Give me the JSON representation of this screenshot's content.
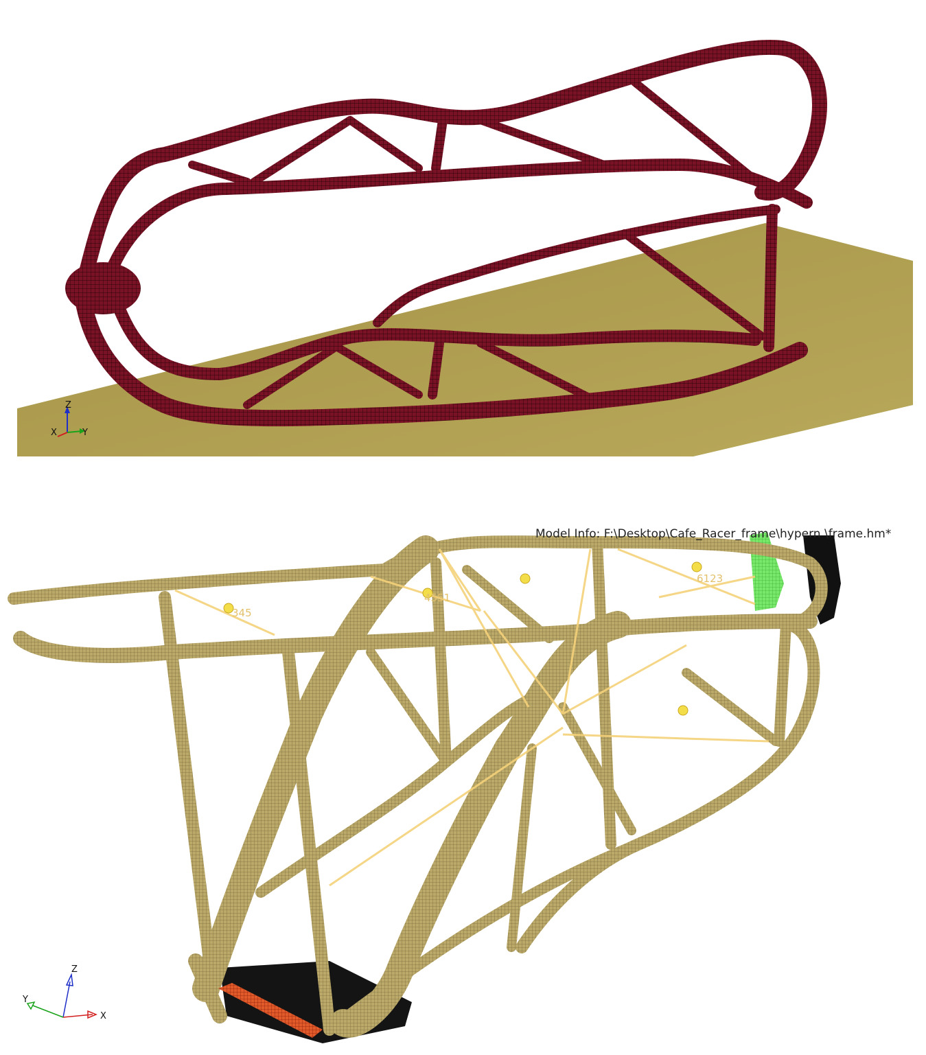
{
  "top_view": {
    "triad": {
      "z": "Z",
      "x": "X",
      "y": "Y"
    },
    "colors": {
      "frame": "#6b1020",
      "frame_mesh": "#3a0710",
      "ground": "#b7a556"
    }
  },
  "bottom_view": {
    "model_info": "Model Info: F:\\Desktop\\Cafe_Racer_frame\\hypern      \\frame.hm*",
    "node_labels": [
      "345",
      "4551",
      "6123"
    ],
    "triad": {
      "z": "Z",
      "x": "X",
      "y": "Y"
    },
    "colors": {
      "frame": "#b9a766",
      "frame_mesh": "#6e6135",
      "rbe": "#f5d27a",
      "constraint": "#6ee25a",
      "load": "#d23a1a"
    }
  }
}
